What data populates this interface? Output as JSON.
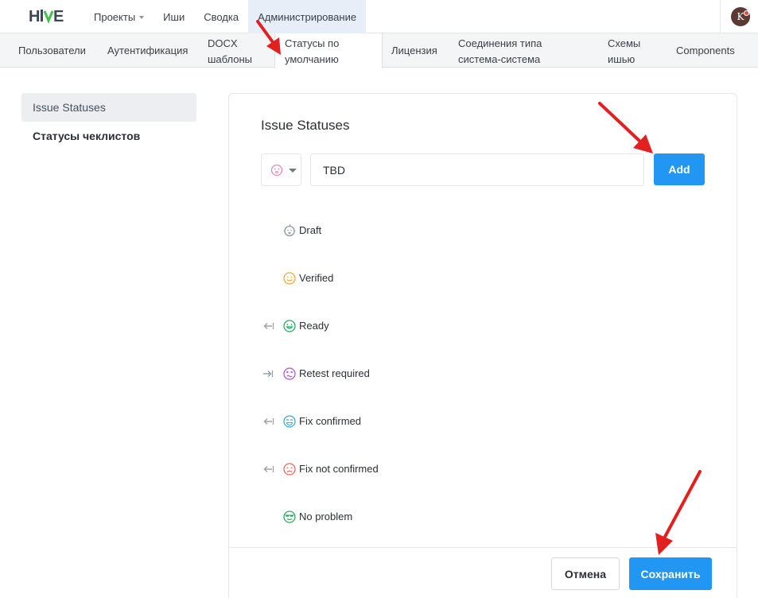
{
  "header": {
    "logo_text": "HiVE",
    "nav": [
      {
        "label": "Проекты",
        "has_dropdown": true
      },
      {
        "label": "Иши"
      },
      {
        "label": "Сводка"
      },
      {
        "label": "Администрирование",
        "active": true
      }
    ],
    "user_initial": "K"
  },
  "admin_tabs": [
    {
      "line1": "Пользователи"
    },
    {
      "line1": "Аутентификация"
    },
    {
      "line1": "DOCX",
      "line2": "шаблоны"
    },
    {
      "line1": "Статусы по",
      "line2": "умолчанию",
      "active": true
    },
    {
      "line1": "Лицензия"
    },
    {
      "line1": "Соединения типа",
      "line2": "система-система"
    },
    {
      "line1": "Схемы",
      "line2": "ишью"
    },
    {
      "line1": "Components"
    }
  ],
  "sidebar": {
    "items": [
      {
        "label": "Issue Statuses",
        "active": true
      },
      {
        "label": "Статусы чеклистов"
      }
    ]
  },
  "card": {
    "title": "Issue Statuses",
    "new_status": {
      "icon": "neutral-face-icon",
      "value": "TBD"
    },
    "add_label": "Add",
    "statuses": [
      {
        "label": "Draft",
        "icon": "baby-face-icon",
        "color": "#8a96a3",
        "arrow": "none"
      },
      {
        "label": "Verified",
        "icon": "smile-face-icon",
        "color": "#f0a93b",
        "arrow": "none"
      },
      {
        "label": "Ready",
        "icon": "happy-face-icon",
        "color": "#27ae60",
        "arrow": "left"
      },
      {
        "label": "Retest required",
        "icon": "dizzy-face-icon",
        "color": "#b455d6",
        "arrow": "right"
      },
      {
        "label": "Fix confirmed",
        "icon": "cry-face-icon",
        "color": "#3aaed8",
        "arrow": "left"
      },
      {
        "label": "Fix not confirmed",
        "icon": "sad-face-icon",
        "color": "#ec6a5e",
        "arrow": "left"
      },
      {
        "label": "No problem",
        "icon": "cool-face-icon",
        "color": "#27ae60",
        "arrow": "none"
      }
    ],
    "cancel_label": "Отмена",
    "save_label": "Сохранить"
  },
  "colors": {
    "primary": "#2196f3",
    "annotation_red": "#e32020",
    "active_nav_bg": "#e8eef7"
  }
}
